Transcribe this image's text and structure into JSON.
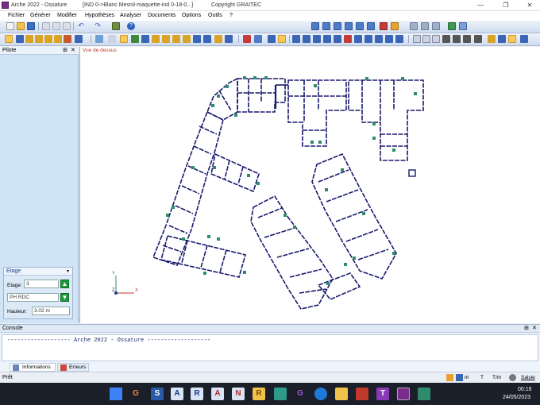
{
  "window": {
    "app_title": "Arche 2022 - Ossature",
    "doc_title": "[IND 0->Blanc Mesnil-maquette-ind 0-18-0...]",
    "copyright": "Copyright GRAITEC",
    "controls": [
      "—",
      "❐",
      "✕"
    ]
  },
  "menu": [
    "Fichier",
    "Générer",
    "Modifier",
    "Hypothèses",
    "Analyser",
    "Documents",
    "Options",
    "Outils",
    "?"
  ],
  "pilote": {
    "title": "Pilote",
    "etage": {
      "title": "Etage",
      "etage_label": "Etage:",
      "etage_value": "3",
      "name_value": "PH RDC",
      "hauteur_label": "Hauteur:",
      "hauteur_value": "3.02 m"
    }
  },
  "view": {
    "label": "Vue de dessus",
    "axis_y": "Y",
    "axis_x": "X",
    "axis_z": "Z"
  },
  "console": {
    "title": "Console",
    "line": "------------------- Arche 2022 - Ossature -------------------",
    "tabs": [
      "Informations",
      "Erreurs"
    ]
  },
  "status": {
    "text": "Prêt",
    "unit1": "m",
    "unit2": "T",
    "unit3": "T/m",
    "saisie": "Saisie"
  },
  "taskbar": {
    "time": "00:16",
    "date": "24/05/2023"
  },
  "colors": {
    "plan_line": "#1a1a6e",
    "node": "#2e8b6e",
    "accent": "#f7c85a"
  }
}
